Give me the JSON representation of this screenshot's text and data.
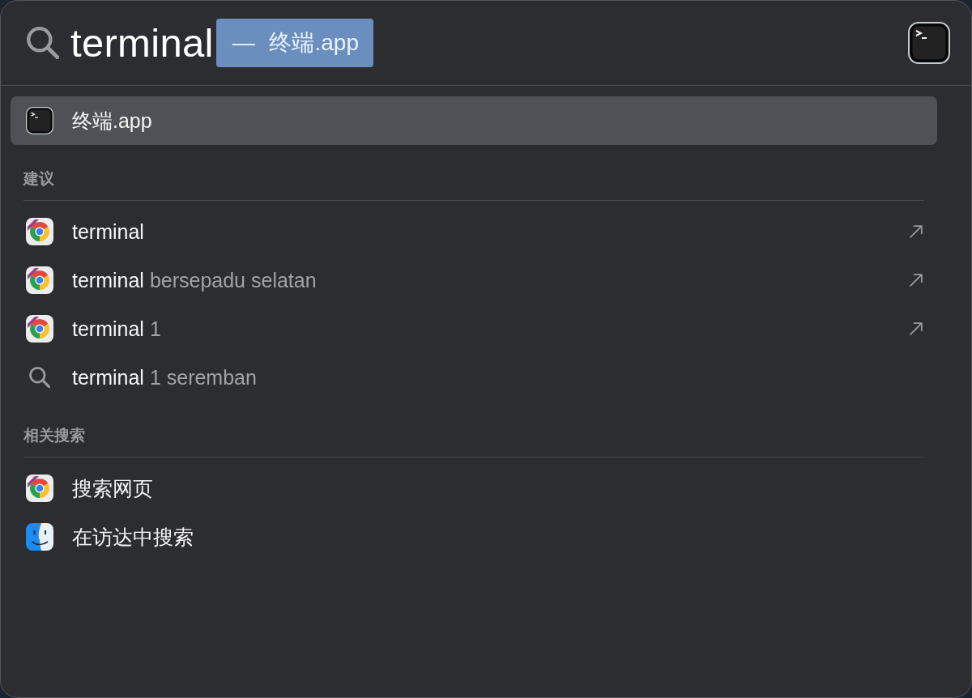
{
  "search": {
    "value": "terminal",
    "completion": "— 终端.app"
  },
  "top_hit": {
    "label": "终端.app",
    "kind": "terminal",
    "selected": true
  },
  "sections": [
    {
      "title": "建议",
      "items": [
        {
          "kind": "browser",
          "label": "terminal",
          "arrow": true,
          "selected": false
        },
        {
          "kind": "browser",
          "label": "terminal",
          "detail": "bersepadu selatan",
          "arrow": true,
          "selected": false
        },
        {
          "kind": "browser",
          "label": "terminal",
          "detail": "1",
          "arrow": true,
          "selected": false
        },
        {
          "kind": "search",
          "label": "terminal",
          "detail": "1 seremban",
          "arrow": false,
          "selected": false
        }
      ]
    },
    {
      "title": "相关搜索",
      "items": [
        {
          "kind": "browser",
          "label": "搜索网页",
          "arrow": false,
          "selected": false
        },
        {
          "kind": "finder",
          "label": "在访达中搜索",
          "arrow": false,
          "selected": false
        }
      ]
    }
  ]
}
